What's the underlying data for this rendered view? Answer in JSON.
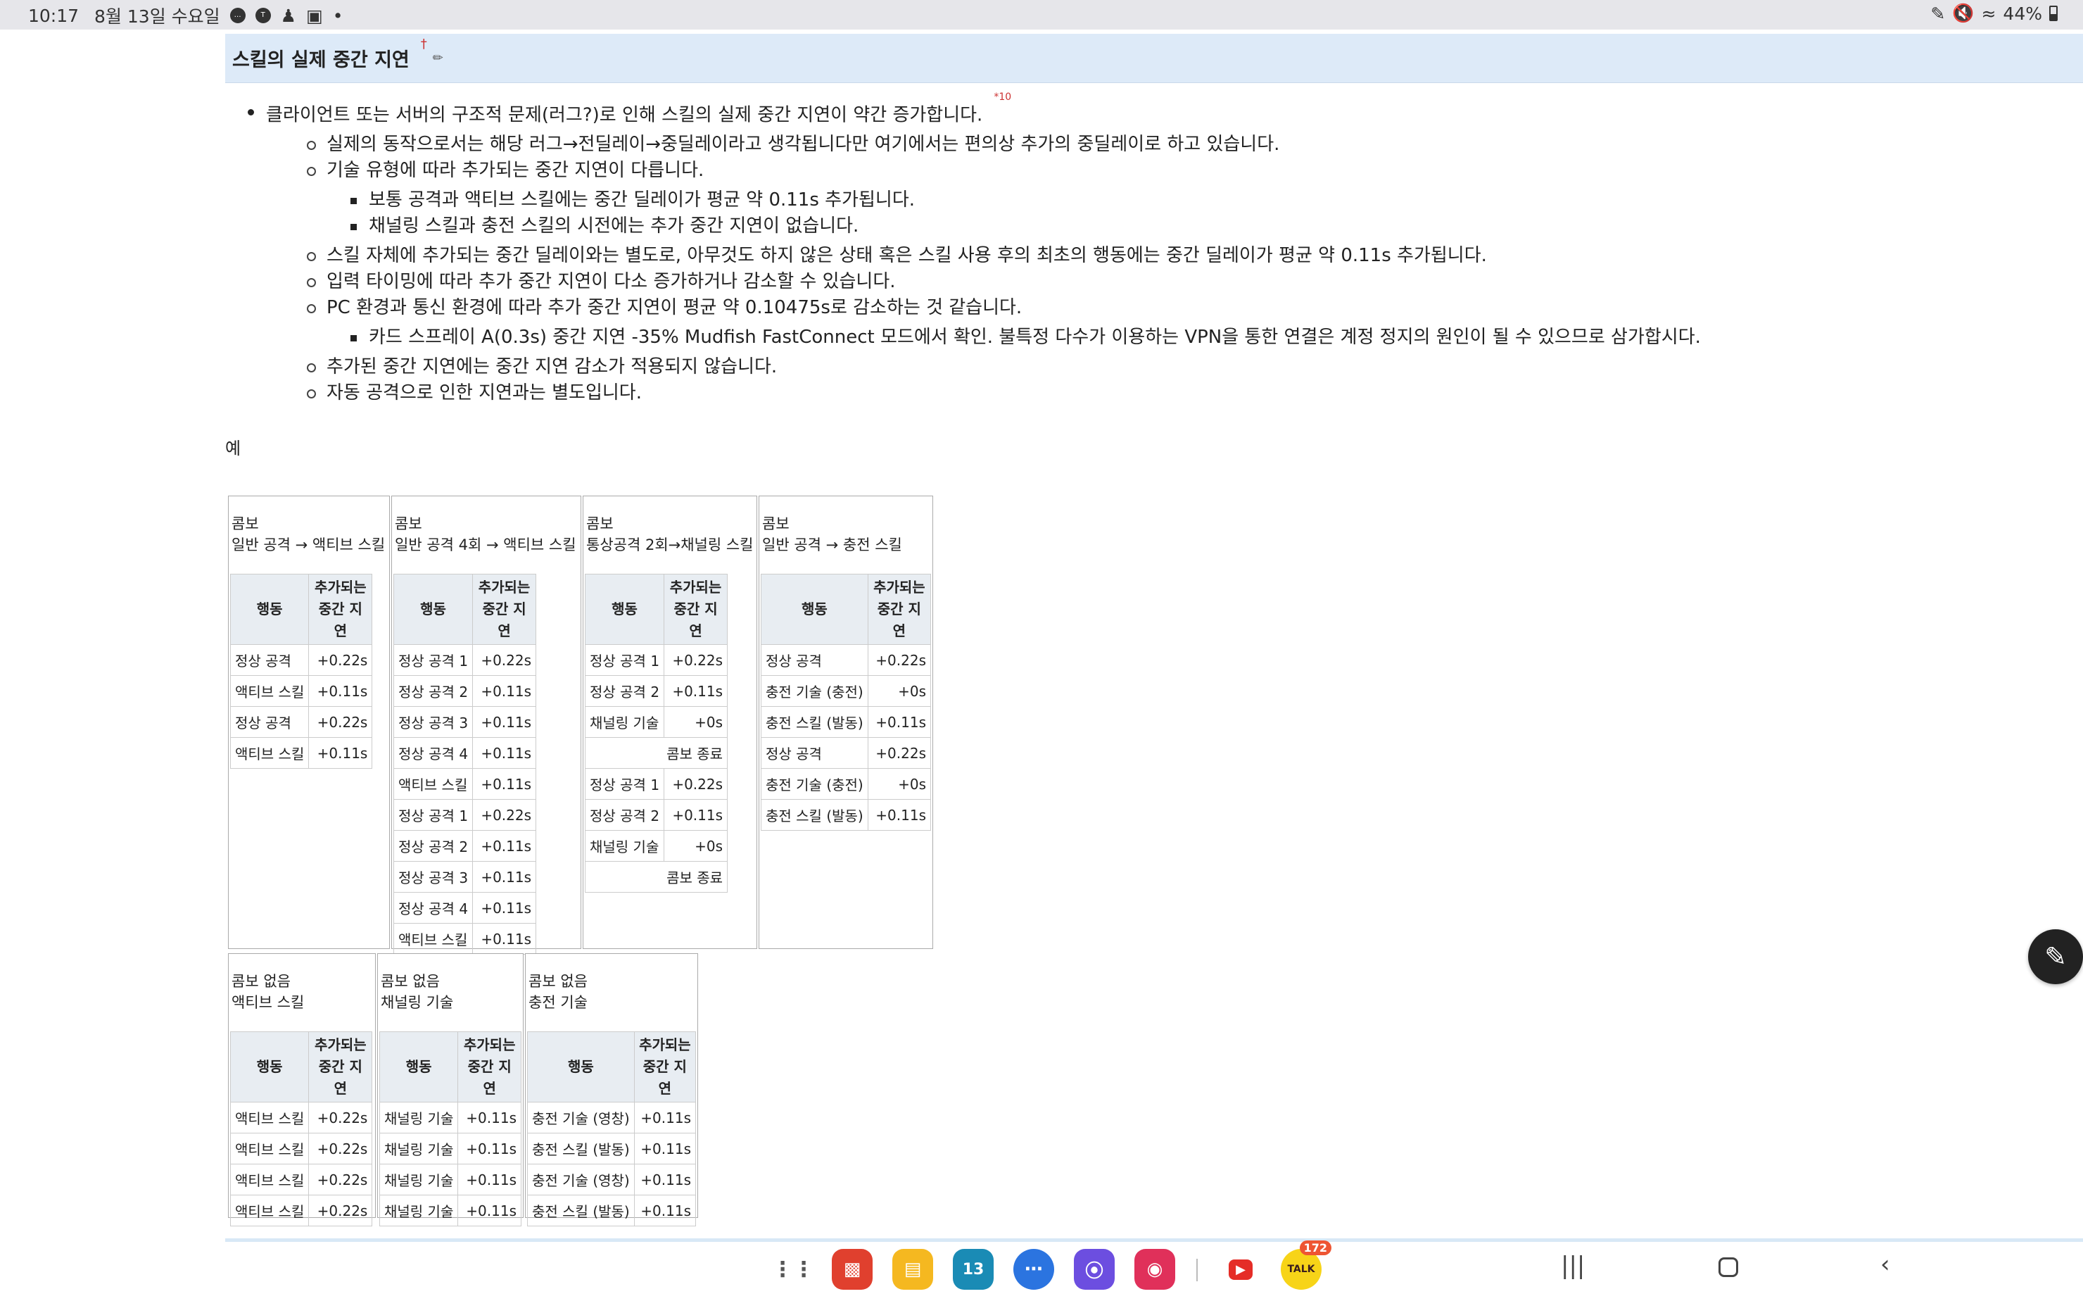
{
  "status": {
    "time": "10:17",
    "date": "8월 13일 수요일",
    "battery": "44%",
    "left_icons": [
      "chat-icon",
      "talk-icon",
      "person-icon",
      "window-icon"
    ],
    "right_icons": [
      "pen-icon",
      "mute-icon",
      "wifi-icon"
    ]
  },
  "section": {
    "title": "스킬의 실제 중간 지연",
    "dagger": "†"
  },
  "bullets": {
    "b1": "클라이언트 또는 서버의 구조적 문제(러그?)로 인해 스킬의 실제 중간 지연이 약간 증가합니다.",
    "b1_fn": "*10",
    "s1": "실제의 동작으로서는 해당 러그→전딜레이→중딜레이라고 생각됩니다만 여기에서는 편의상 추가의 중딜레이로 하고 있습니다.",
    "s2": "기술 유형에 따라 추가되는 중간 지연이 다릅니다.",
    "s2a": "보통 공격과 액티브 스킬에는 중간 딜레이가 평균 약 0.11s 추가됩니다.",
    "s2b": "채널링 스킬과 충전 스킬의 시전에는 추가 중간 지연이 없습니다.",
    "s3": "스킬 자체에 추가되는 중간 딜레이와는 별도로, 아무것도 하지 않은 상태 혹은 스킬 사용 후의 최초의 행동에는 중간 딜레이가 평균 약 0.11s 추가됩니다.",
    "s4": "입력 타이밍에 따라 추가 중간 지연이 다소 증가하거나 감소할 수 있습니다.",
    "s5": "PC 환경과 통신 환경에 따라 추가 중간 지연이 평균 약 0.10475s로 감소하는 것 같습니다.",
    "s5a": "카드 스프레이 A(0.3s) 중간 지연 -35% Mudfish FastConnect 모드에서 확인. 불특정 다수가 이용하는 VPN을 통한 연결은 계정 정지의 원인이 될 수 있으므로 삼가합시다.",
    "s6": "추가된 중간 지연에는 중간 지연 감소가 적용되지 않습니다.",
    "s7": "자동 공격으로 인한 지연과는 별도입니다."
  },
  "example_label": "예",
  "headers": {
    "action": "행동",
    "delay1": "추가되는",
    "delay2": "중간 지연"
  },
  "combos_row1": [
    {
      "t1": "콤보",
      "t2": "일반 공격 → 액티브 스킬",
      "rows": [
        [
          "정상 공격",
          "+0.22s"
        ],
        [
          "액티브 스킬",
          "+0.11s"
        ],
        [
          "정상 공격",
          "+0.22s"
        ],
        [
          "액티브 스킬",
          "+0.11s"
        ]
      ]
    },
    {
      "t1": "콤보",
      "t2": "일반 공격 4회 → 액티브 스킬",
      "rows": [
        [
          "정상 공격 1",
          "+0.22s"
        ],
        [
          "정상 공격 2",
          "+0.11s"
        ],
        [
          "정상 공격 3",
          "+0.11s"
        ],
        [
          "정상 공격 4",
          "+0.11s"
        ],
        [
          "액티브 스킬",
          "+0.11s"
        ],
        [
          "정상 공격 1",
          "+0.22s"
        ],
        [
          "정상 공격 2",
          "+0.11s"
        ],
        [
          "정상 공격 3",
          "+0.11s"
        ],
        [
          "정상 공격 4",
          "+0.11s"
        ],
        [
          "액티브 스킬",
          "+0.11s"
        ]
      ]
    },
    {
      "t1": "콤보",
      "t2": "통상공격 2회→채널링 스킬",
      "rows": [
        [
          "정상 공격 1",
          "+0.22s"
        ],
        [
          "정상 공격 2",
          "+0.11s"
        ],
        [
          "채널링 기술",
          "+0s"
        ],
        [
          "",
          "콤보 종료"
        ],
        [
          "정상 공격 1",
          "+0.22s"
        ],
        [
          "정상 공격 2",
          "+0.11s"
        ],
        [
          "채널링 기술",
          "+0s"
        ],
        [
          "",
          "콤보 종료"
        ]
      ]
    },
    {
      "t1": "콤보",
      "t2": "일반 공격 → 충전 스킬",
      "rows": [
        [
          "정상 공격",
          "+0.22s"
        ],
        [
          "충전 기술 (충전)",
          "+0s"
        ],
        [
          "충전 스킬 (발동)",
          "+0.11s"
        ],
        [
          "정상 공격",
          "+0.22s"
        ],
        [
          "충전 기술 (충전)",
          "+0s"
        ],
        [
          "충전 스킬 (발동)",
          "+0.11s"
        ]
      ]
    }
  ],
  "combos_row2": [
    {
      "t1": "콤보 없음",
      "t2": "액티브 스킬",
      "rows": [
        [
          "액티브 스킬",
          "+0.22s"
        ],
        [
          "액티브 스킬",
          "+0.22s"
        ],
        [
          "액티브 스킬",
          "+0.22s"
        ],
        [
          "액티브 스킬",
          "+0.22s"
        ]
      ]
    },
    {
      "t1": "콤보 없음",
      "t2": "채널링 기술",
      "rows": [
        [
          "채널링 기술",
          "+0.11s"
        ],
        [
          "채널링 기술",
          "+0.11s"
        ],
        [
          "채널링 기술",
          "+0.11s"
        ],
        [
          "채널링 기술",
          "+0.11s"
        ]
      ]
    },
    {
      "t1": "콤보 없음",
      "t2": "충전 기술",
      "rows": [
        [
          "충전 기술 (영창)",
          "+0.11s"
        ],
        [
          "충전 스킬 (발동)",
          "+0.11s"
        ],
        [
          "충전 기술 (영창)",
          "+0.11s"
        ],
        [
          "충전 스킬 (발동)",
          "+0.11s"
        ]
      ]
    }
  ],
  "dock": {
    "talk_badge": "172",
    "calendar_day": "13",
    "talk_label": "TALK",
    "apps": [
      "apps-grid-icon",
      "notes-app-icon",
      "files-app-icon",
      "calendar-app-icon",
      "messages-app-icon",
      "browser-app-icon",
      "camera-app-icon",
      "youtube-app-icon",
      "kakaotalk-app-icon"
    ]
  },
  "colors": {
    "section_bg": "#ddeaf8",
    "th_bg": "#e8edf2",
    "status_bg": "#e6e6ea"
  }
}
